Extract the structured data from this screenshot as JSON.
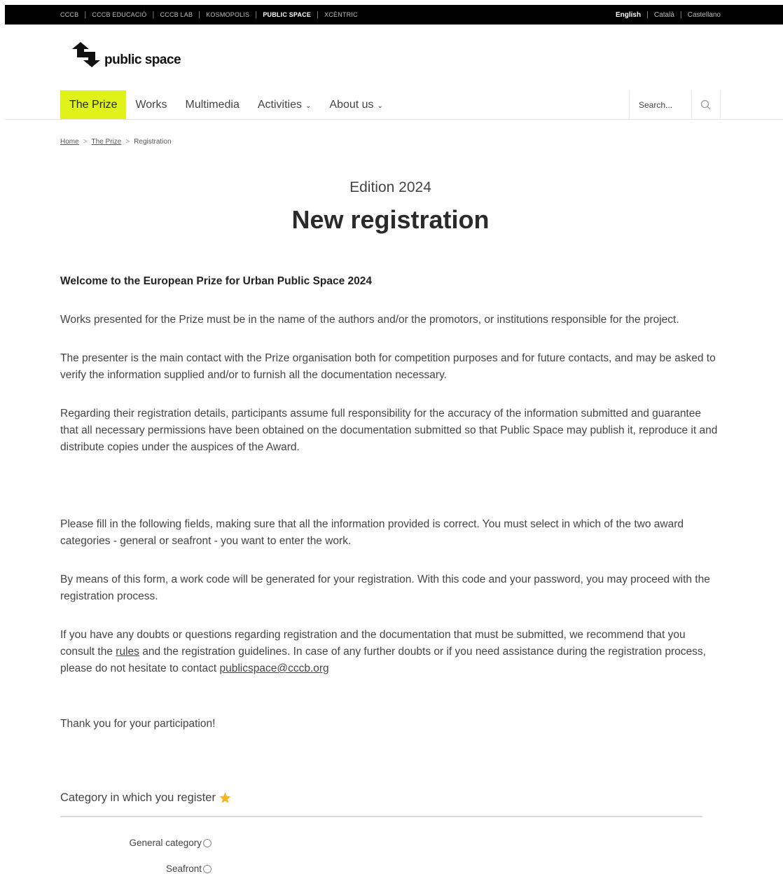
{
  "topbar": {
    "sites": [
      "CCCB",
      "CCCB EDUCACIÓ",
      "CCCB LAB",
      "KOSMOPOLIS",
      "PUBLIC SPACE",
      "XCÈNTRIC"
    ],
    "active_site": "PUBLIC SPACE",
    "languages": [
      "English",
      "Català",
      "Castellano"
    ],
    "active_language": "English"
  },
  "logo": {
    "text": "public space",
    "icon": "arrows-logo-icon"
  },
  "nav": {
    "items": [
      {
        "label": "The Prize",
        "active": true,
        "dropdown": false
      },
      {
        "label": "Works",
        "active": false,
        "dropdown": false
      },
      {
        "label": "Multimedia",
        "active": false,
        "dropdown": false
      },
      {
        "label": "Activities",
        "active": false,
        "dropdown": true
      },
      {
        "label": "About us",
        "active": false,
        "dropdown": true
      }
    ],
    "accent_color": "#dff21a",
    "search_placeholder": "Search...",
    "search_icon": "search-icon"
  },
  "breadcrumb": {
    "home": "Home",
    "prize": "The Prize",
    "current": "Registration"
  },
  "main": {
    "edition": "Edition 2024",
    "title": "New registration",
    "welcome": "Welcome to the European Prize for Urban Public Space 2024",
    "p1": "Works presented for the Prize must be in the name of the authors and/or the promotors, or institutions responsible for the project.",
    "p2": "The presenter is the main contact with the Prize organisation both for competition purposes and for future contacts, and may be asked to verify the information supplied and/or to furnish all the documentation necessary.",
    "p3": "Regarding their registration details, participants assume full responsibility for the accuracy of the information submitted and guarantee that all necessary permissions have been obtained on the documentation submitted so that Public Space may publish it, reproduce it and distribute copies under the auspices of the Award.",
    "p4": "Please fill in the following fields, making sure that all the information provided is correct. You must select in which of the two award categories - general or seafront -  you want to enter the work.",
    "p5": "By means of this form, a work code will be generated for your registration. With this code and your password, you may proceed with the registration process.",
    "p6_before": "If you have any doubts or questions regarding registration and the documentation that must be submitted, we recommend that you consult the ",
    "p6_rules": "rules",
    "p6_middle": " and the registration guidelines.  In case of any further doubts or if you need assistance during the registration process, please do not hesitate to contact ",
    "p6_email": "publicspace@cccb.org",
    "thanks": "Thank you for your participation!"
  },
  "category": {
    "label": "Category in which you register",
    "required_icon": "star-icon",
    "options": [
      "General category",
      "Seafront"
    ]
  }
}
